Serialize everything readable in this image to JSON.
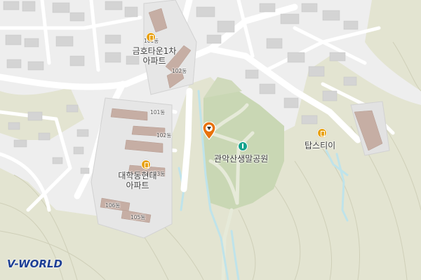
{
  "map": {
    "colors": {
      "background": "#eeeeee",
      "terrain": "#e3e4d1",
      "park": "#c9d7b4",
      "building": "#d4d4d4",
      "apartment": "#c6aea4",
      "road": "#ffffff",
      "stream": "#bfe3ea",
      "poi": "#e8a317",
      "park_poi": "#14a38c",
      "marker": "#e8710a"
    },
    "labels": {
      "apt1_name": "금호타운1차",
      "apt1_sub": "아파트",
      "apt1_b101": "101동",
      "apt1_b102": "102동",
      "apt2_name": "대학동현대",
      "apt2_sub": "아파트",
      "apt2_b101": "101동",
      "apt2_b102": "102동",
      "apt2_b103": "103동",
      "apt2_b105": "105동",
      "apt2_b106": "106동",
      "park": "관악산생말공원",
      "poi_topstyle": "탑스티이"
    },
    "icons": {
      "apartment_poi": "building-icon",
      "park_poi": "tree-icon",
      "location_marker": "map-pin-icon"
    },
    "logo": "V-WORLD"
  }
}
